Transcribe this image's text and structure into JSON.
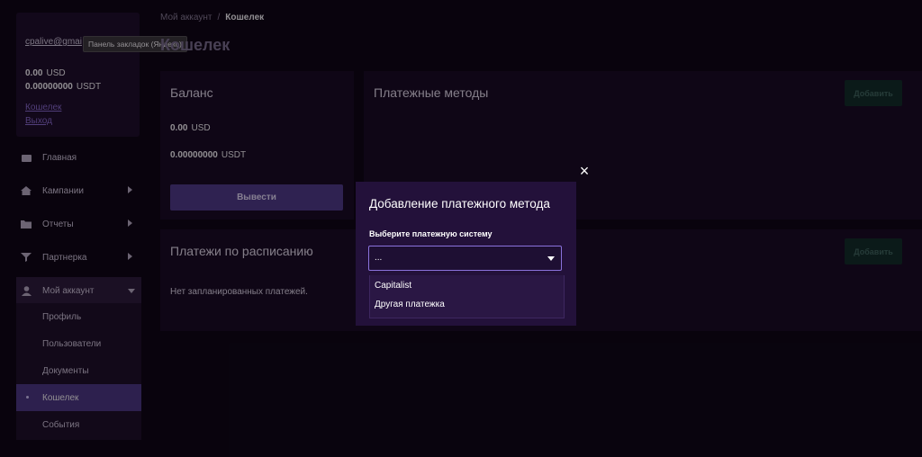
{
  "account": {
    "email": "cpalive@gmai",
    "balances": [
      {
        "amount": "0.00",
        "currency": "USD"
      },
      {
        "amount": "0.00000000",
        "currency": "USDT"
      }
    ],
    "links": {
      "wallet": "Кошелек",
      "logout": "Выход"
    },
    "tooltip": "Панель закладок (Яндекс)"
  },
  "nav": {
    "items": [
      {
        "label": "Главная",
        "icon": "wallet-icon"
      },
      {
        "label": "Кампании",
        "icon": "home-icon"
      },
      {
        "label": "Отчеты",
        "icon": "folder-icon"
      },
      {
        "label": "Партнерка",
        "icon": "funnel-icon"
      },
      {
        "label": "Мой аккаунт",
        "icon": "user-icon"
      }
    ],
    "submenu": [
      "Профиль",
      "Пользователи",
      "Документы",
      "Кошелек",
      "События"
    ]
  },
  "breadcrumb": {
    "parent": "Мой аккаунт",
    "separator": "/",
    "current": "Кошелек"
  },
  "page_title": "Кошелек",
  "balance_card": {
    "title": "Баланс",
    "rows": [
      {
        "amount": "0.00",
        "currency": "USD"
      },
      {
        "amount": "0.00000000",
        "currency": "USDT"
      }
    ],
    "withdraw_label": "Вывести"
  },
  "payment_methods": {
    "title": "Платежные методы",
    "add_label": "Добавить"
  },
  "scheduled": {
    "title": "Платежи по расписанию",
    "empty": "Нет запланированных платежей.",
    "add_label": "Добавить"
  },
  "modal": {
    "close": "×",
    "title": "Добавление платежного метода",
    "label": "Выберите платежную систему",
    "selected": "...",
    "options": [
      "Capitalist",
      "Другая платежка"
    ]
  },
  "colors": {
    "accent": "#4f3c8b",
    "select_border": "#8a72dc",
    "background": "#0a0510"
  }
}
